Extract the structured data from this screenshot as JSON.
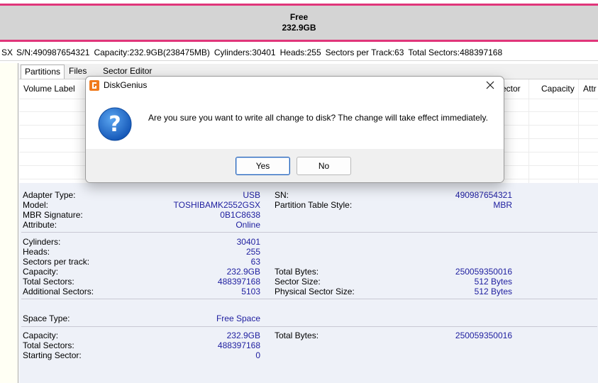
{
  "disk_bar": {
    "free_label": "Free",
    "free_size": "232.9GB"
  },
  "disk_info": {
    "model_tail": "SX",
    "serial": "S/N:490987654321",
    "capacity": "Capacity:232.9GB(238475MB)",
    "cylinders": "Cylinders:30401",
    "heads": "Heads:255",
    "sectors_per_track": "Sectors per Track:63",
    "total_sectors": "Total Sectors:488397168"
  },
  "tabs": [
    {
      "label": "Partitions",
      "active": true
    },
    {
      "label": "Files",
      "active": false
    },
    {
      "label": "Sector Editor",
      "active": false
    }
  ],
  "grid": {
    "headers": {
      "volume_label": "Volume Label",
      "sector": "ector",
      "capacity": "Capacity",
      "attribute": "Attr"
    }
  },
  "details": {
    "section1": {
      "adapter_type": {
        "label": "Adapter Type:",
        "value": "USB"
      },
      "model": {
        "label": "Model:",
        "value": "TOSHIBAMK2552GSX"
      },
      "mbr_signature": {
        "label": "MBR Signature:",
        "value": "0B1C8638"
      },
      "attribute": {
        "label": "Attribute:",
        "value": "Online"
      },
      "sn": {
        "label": "SN:",
        "value": "490987654321"
      },
      "partition_table_style": {
        "label": "Partition Table Style:",
        "value": "MBR"
      }
    },
    "section2": {
      "cylinders": {
        "label": "Cylinders:",
        "value": "30401"
      },
      "heads": {
        "label": "Heads:",
        "value": "255"
      },
      "sectors_per_track": {
        "label": "Sectors per track:",
        "value": "63"
      },
      "capacity": {
        "label": "Capacity:",
        "value": "232.9GB"
      },
      "total_sectors": {
        "label": "Total Sectors:",
        "value": "488397168"
      },
      "additional_sectors": {
        "label": "Additional Sectors:",
        "value": "5103"
      },
      "total_bytes": {
        "label": "Total Bytes:",
        "value": "250059350016"
      },
      "sector_size": {
        "label": "Sector Size:",
        "value": "512 Bytes"
      },
      "physical_sector_size": {
        "label": "Physical Sector Size:",
        "value": "512 Bytes"
      }
    },
    "section3": {
      "space_type": {
        "label": "Space Type:",
        "value": "Free Space"
      }
    },
    "section4": {
      "capacity": {
        "label": "Capacity:",
        "value": "232.9GB"
      },
      "total_sectors": {
        "label": "Total Sectors:",
        "value": "488397168"
      },
      "starting_sector": {
        "label": "Starting Sector:",
        "value": "0"
      },
      "total_bytes": {
        "label": "Total Bytes:",
        "value": "250059350016"
      }
    }
  },
  "dialog": {
    "title": "DiskGenius",
    "message": "Are you sure you want to write all change to disk? The change will take effect immediately.",
    "yes_label": "Yes",
    "no_label": "No",
    "icon": "question-icon",
    "app_icon": "diskgenius-icon"
  },
  "colors": {
    "partition_border": "#e0357a",
    "free_space": "#d4d4d4",
    "value_text": "#2020a0",
    "details_bg": "#eef1f8",
    "question_icon": "#1a66c4"
  }
}
